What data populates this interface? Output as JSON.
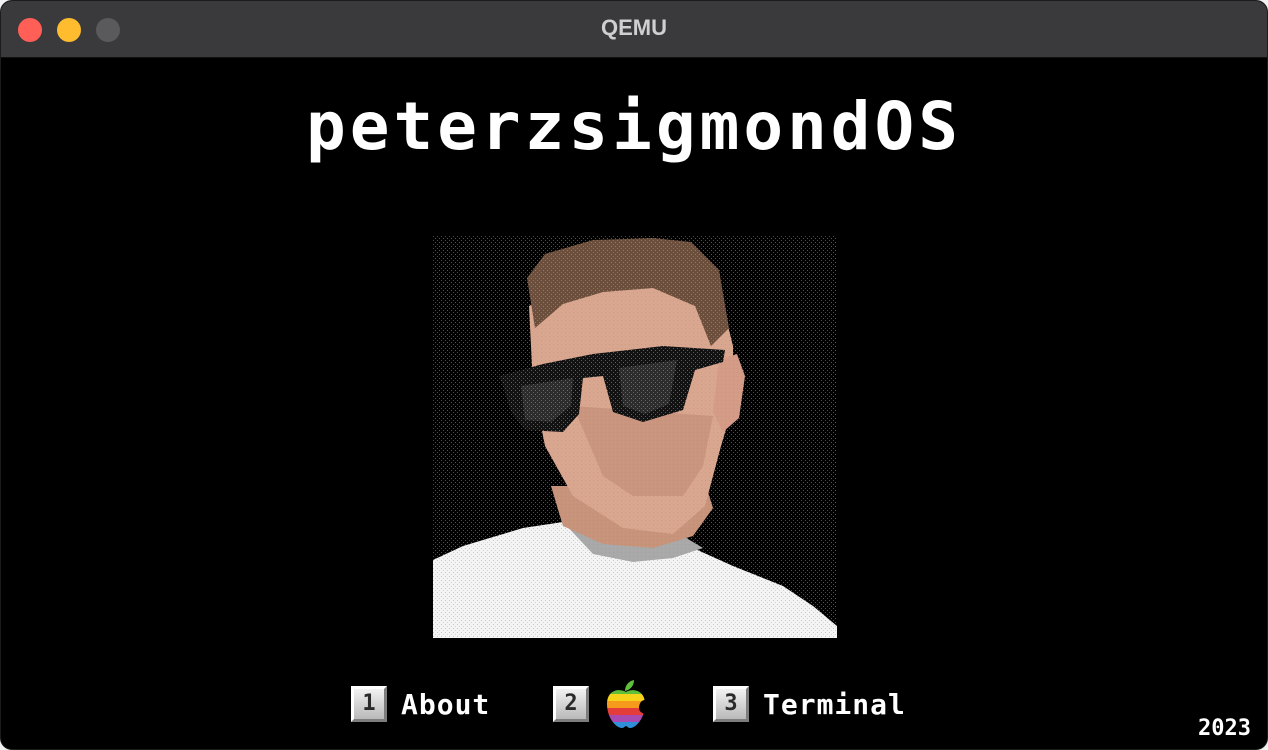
{
  "window": {
    "title": "QEMU"
  },
  "os": {
    "title": "peterzsigmondOS",
    "year": "2023"
  },
  "menu": {
    "items": [
      {
        "key": "1",
        "label": "About"
      },
      {
        "key": "2",
        "icon": "rainbow-apple-icon"
      },
      {
        "key": "3",
        "label": "Terminal"
      }
    ]
  },
  "colors": {
    "titlebar": "#3a3a3c",
    "screen_bg": "#000000",
    "close": "#ff5f57",
    "minimize": "#febc2e",
    "maximize_disabled": "#5a5a5c"
  }
}
